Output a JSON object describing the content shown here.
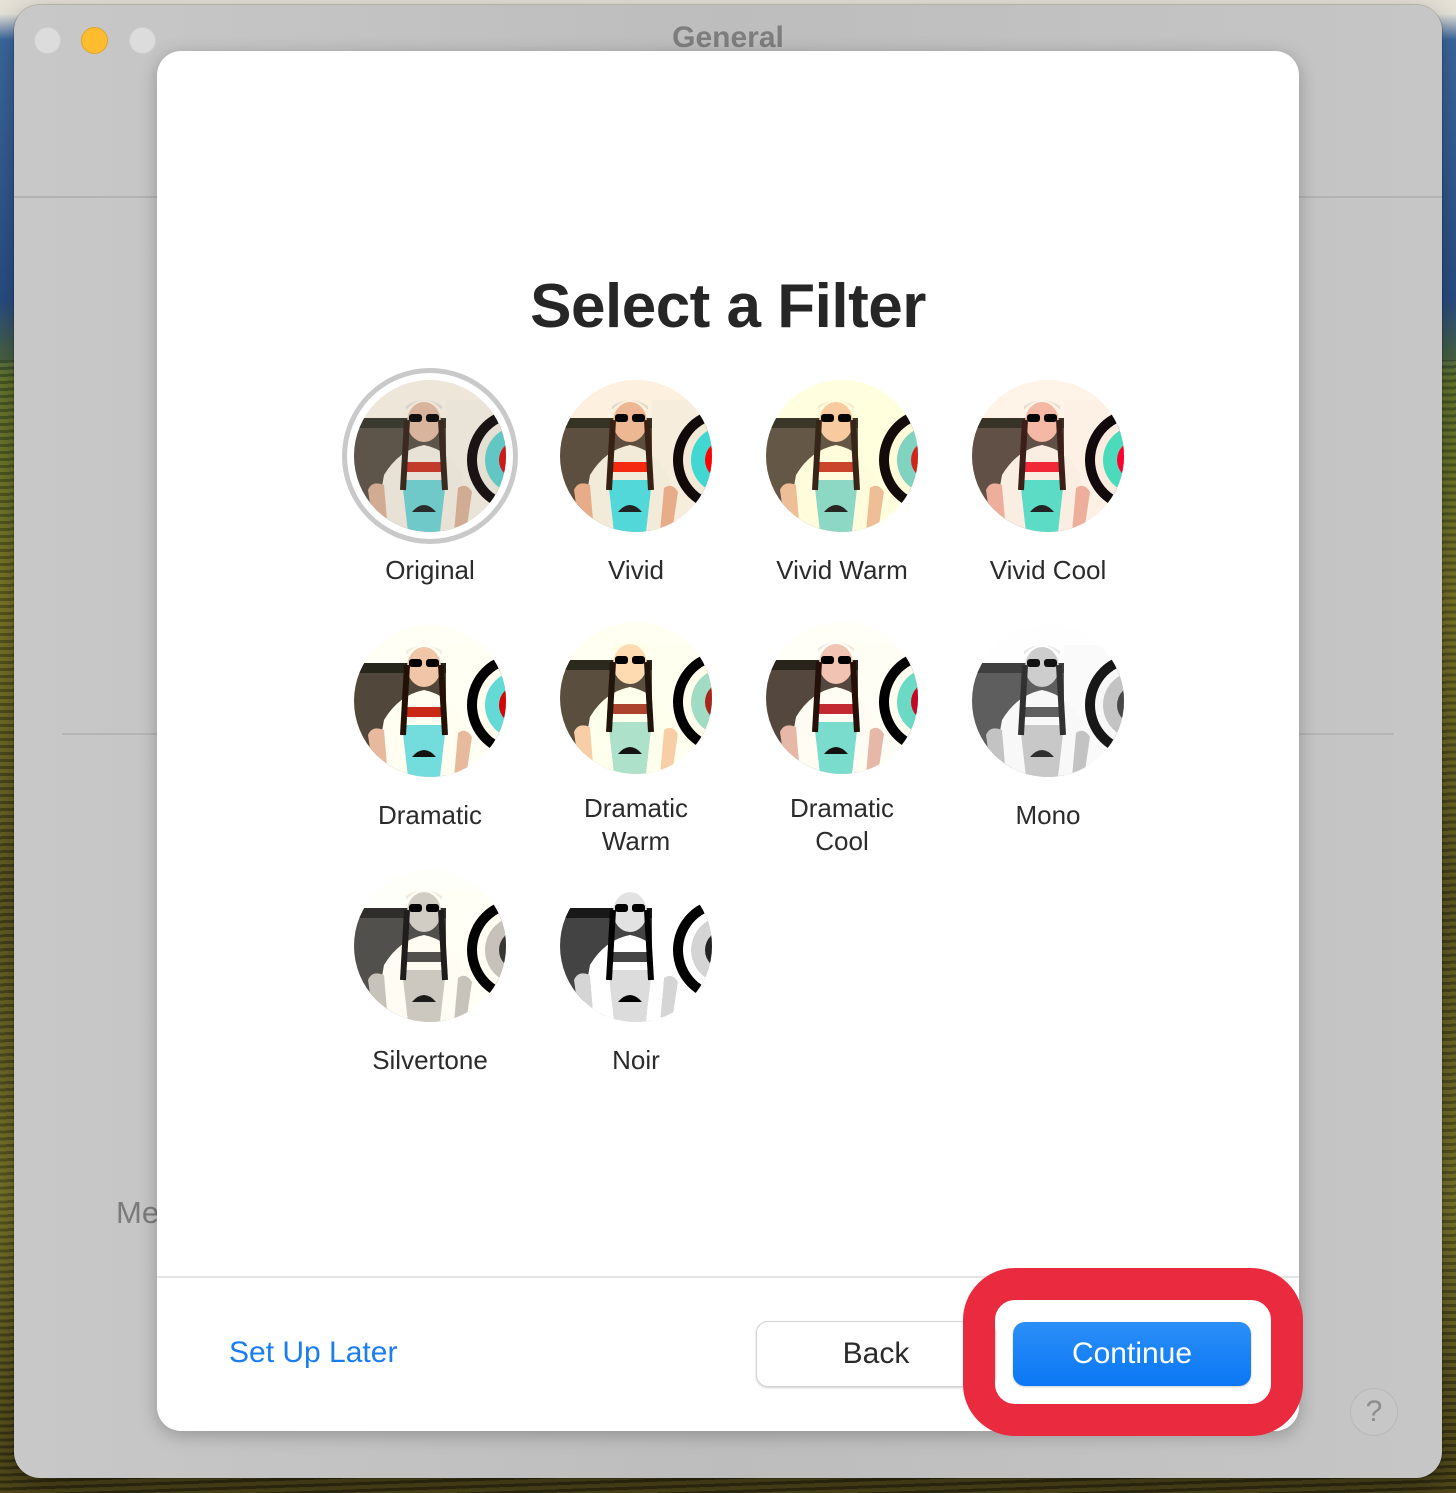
{
  "window": {
    "title": "General",
    "background_label_partial": "Me",
    "help_label": "?"
  },
  "dialog": {
    "title": "Select a Filter",
    "selected_filter": "Original",
    "filters": [
      {
        "label": "Original",
        "tone": "original"
      },
      {
        "label": "Vivid",
        "tone": "vivid"
      },
      {
        "label": "Vivid Warm",
        "tone": "vivid-warm"
      },
      {
        "label": "Vivid Cool",
        "tone": "vivid-cool"
      },
      {
        "label": "Dramatic",
        "tone": "dramatic"
      },
      {
        "label": "Dramatic\nWarm",
        "tone": "dramatic-warm"
      },
      {
        "label": "Dramatic\nCool",
        "tone": "dramatic-cool"
      },
      {
        "label": "Mono",
        "tone": "mono"
      },
      {
        "label": "Silvertone",
        "tone": "silvertone"
      },
      {
        "label": "Noir",
        "tone": "noir"
      }
    ],
    "footer": {
      "setup_later": "Set Up Later",
      "back": "Back",
      "continue": "Continue"
    }
  },
  "colors": {
    "accent": "#0a77f5",
    "link": "#1a7df0",
    "highlight": "#ea2a3e",
    "minimize": "#febc2e"
  }
}
